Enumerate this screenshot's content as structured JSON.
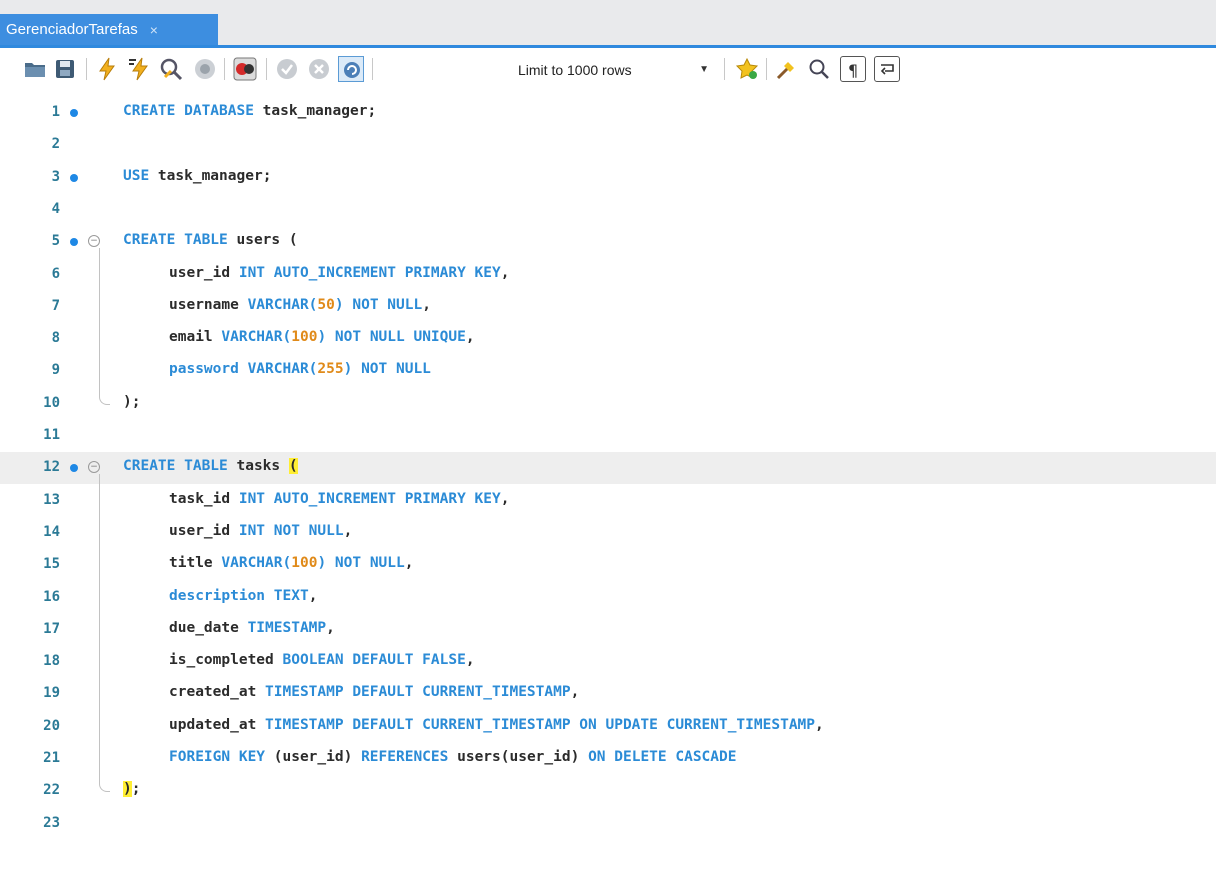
{
  "tab": {
    "title": "GerenciadorTarefas",
    "close": "×"
  },
  "toolbar": {
    "limit_label": "Limit to 1000 rows",
    "icons": [
      "open-folder-icon",
      "save-icon",
      "execute-icon",
      "execute-current-icon",
      "explain-icon",
      "stop-icon",
      "toggle-errors-icon",
      "commit-icon",
      "rollback-icon",
      "autocommit-icon",
      "limit-dropdown",
      "add-snippet-icon",
      "beautify-icon",
      "find-icon",
      "invisible-chars-icon",
      "word-wrap-icon"
    ]
  },
  "editor": {
    "current_line": 12,
    "lines": [
      {
        "n": "1",
        "marker": true,
        "fold": false,
        "indent": false,
        "tokens": [
          [
            "kw",
            "CREATE DATABASE"
          ],
          [
            "t",
            " task_manager;"
          ]
        ]
      },
      {
        "n": "2",
        "marker": false,
        "fold": false,
        "indent": false,
        "tokens": []
      },
      {
        "n": "3",
        "marker": true,
        "fold": false,
        "indent": false,
        "tokens": [
          [
            "kw",
            "USE"
          ],
          [
            "t",
            " task_manager;"
          ]
        ]
      },
      {
        "n": "4",
        "marker": false,
        "fold": false,
        "indent": false,
        "tokens": []
      },
      {
        "n": "5",
        "marker": true,
        "fold": true,
        "indent": false,
        "tokens": [
          [
            "kw",
            "CREATE TABLE"
          ],
          [
            "t",
            " users ("
          ]
        ]
      },
      {
        "n": "6",
        "marker": false,
        "fold": false,
        "indent": true,
        "tokens": [
          [
            "t",
            "user_id "
          ],
          [
            "kw",
            "INT AUTO_INCREMENT PRIMARY KEY"
          ],
          [
            "t",
            ","
          ]
        ]
      },
      {
        "n": "7",
        "marker": false,
        "fold": false,
        "indent": true,
        "tokens": [
          [
            "t",
            "username "
          ],
          [
            "kw",
            "VARCHAR("
          ],
          [
            "num",
            "50"
          ],
          [
            "kw",
            ")"
          ],
          [
            "t",
            " "
          ],
          [
            "kw",
            "NOT NULL"
          ],
          [
            "t",
            ","
          ]
        ]
      },
      {
        "n": "8",
        "marker": false,
        "fold": false,
        "indent": true,
        "tokens": [
          [
            "t",
            "email "
          ],
          [
            "kw",
            "VARCHAR("
          ],
          [
            "num",
            "100"
          ],
          [
            "kw",
            ")"
          ],
          [
            "t",
            " "
          ],
          [
            "kw",
            "NOT NULL UNIQUE"
          ],
          [
            "t",
            ","
          ]
        ]
      },
      {
        "n": "9",
        "marker": false,
        "fold": false,
        "indent": true,
        "tokens": [
          [
            "kw",
            "password VARCHAR("
          ],
          [
            "num",
            "255"
          ],
          [
            "kw",
            ")"
          ],
          [
            "t",
            " "
          ],
          [
            "kw",
            "NOT NULL"
          ]
        ]
      },
      {
        "n": "10",
        "marker": false,
        "fold": false,
        "indent": false,
        "tokens": [
          [
            "t",
            ");"
          ]
        ]
      },
      {
        "n": "11",
        "marker": false,
        "fold": false,
        "indent": false,
        "tokens": []
      },
      {
        "n": "12",
        "marker": true,
        "fold": true,
        "indent": false,
        "tokens": [
          [
            "kw",
            "CREATE TABLE"
          ],
          [
            "t",
            " tasks "
          ],
          [
            "hl",
            "("
          ]
        ]
      },
      {
        "n": "13",
        "marker": false,
        "fold": false,
        "indent": true,
        "tokens": [
          [
            "t",
            "task_id "
          ],
          [
            "kw",
            "INT AUTO_INCREMENT PRIMARY KEY"
          ],
          [
            "t",
            ","
          ]
        ]
      },
      {
        "n": "14",
        "marker": false,
        "fold": false,
        "indent": true,
        "tokens": [
          [
            "t",
            "user_id "
          ],
          [
            "kw",
            "INT NOT NULL"
          ],
          [
            "t",
            ","
          ]
        ]
      },
      {
        "n": "15",
        "marker": false,
        "fold": false,
        "indent": true,
        "tokens": [
          [
            "t",
            "title "
          ],
          [
            "kw",
            "VARCHAR("
          ],
          [
            "num",
            "100"
          ],
          [
            "kw",
            ")"
          ],
          [
            "t",
            " "
          ],
          [
            "kw",
            "NOT NULL"
          ],
          [
            "t",
            ","
          ]
        ]
      },
      {
        "n": "16",
        "marker": false,
        "fold": false,
        "indent": true,
        "tokens": [
          [
            "kw",
            "description TEXT"
          ],
          [
            "t",
            ","
          ]
        ]
      },
      {
        "n": "17",
        "marker": false,
        "fold": false,
        "indent": true,
        "tokens": [
          [
            "t",
            "due_date "
          ],
          [
            "kw",
            "TIMESTAMP"
          ],
          [
            "t",
            ","
          ]
        ]
      },
      {
        "n": "18",
        "marker": false,
        "fold": false,
        "indent": true,
        "tokens": [
          [
            "t",
            "is_completed "
          ],
          [
            "kw",
            "BOOLEAN DEFAULT FALSE"
          ],
          [
            "t",
            ","
          ]
        ]
      },
      {
        "n": "19",
        "marker": false,
        "fold": false,
        "indent": true,
        "tokens": [
          [
            "t",
            "created_at "
          ],
          [
            "kw",
            "TIMESTAMP DEFAULT CURRENT_TIMESTAMP"
          ],
          [
            "t",
            ","
          ]
        ]
      },
      {
        "n": "20",
        "marker": false,
        "fold": false,
        "indent": true,
        "tokens": [
          [
            "t",
            "updated_at "
          ],
          [
            "kw",
            "TIMESTAMP DEFAULT CURRENT_TIMESTAMP ON UPDATE CURRENT_TIMESTAMP"
          ],
          [
            "t",
            ","
          ]
        ]
      },
      {
        "n": "21",
        "marker": false,
        "fold": false,
        "indent": true,
        "tokens": [
          [
            "kw",
            "FOREIGN KEY"
          ],
          [
            "t",
            " (user_id) "
          ],
          [
            "kw",
            "REFERENCES"
          ],
          [
            "t",
            " users(user_id) "
          ],
          [
            "kw",
            "ON DELETE CASCADE"
          ]
        ]
      },
      {
        "n": "22",
        "marker": false,
        "fold": false,
        "indent": false,
        "tokens": [
          [
            "hl",
            ")"
          ],
          [
            "t",
            ";"
          ]
        ]
      },
      {
        "n": "23",
        "marker": false,
        "fold": false,
        "indent": false,
        "tokens": []
      }
    ]
  }
}
